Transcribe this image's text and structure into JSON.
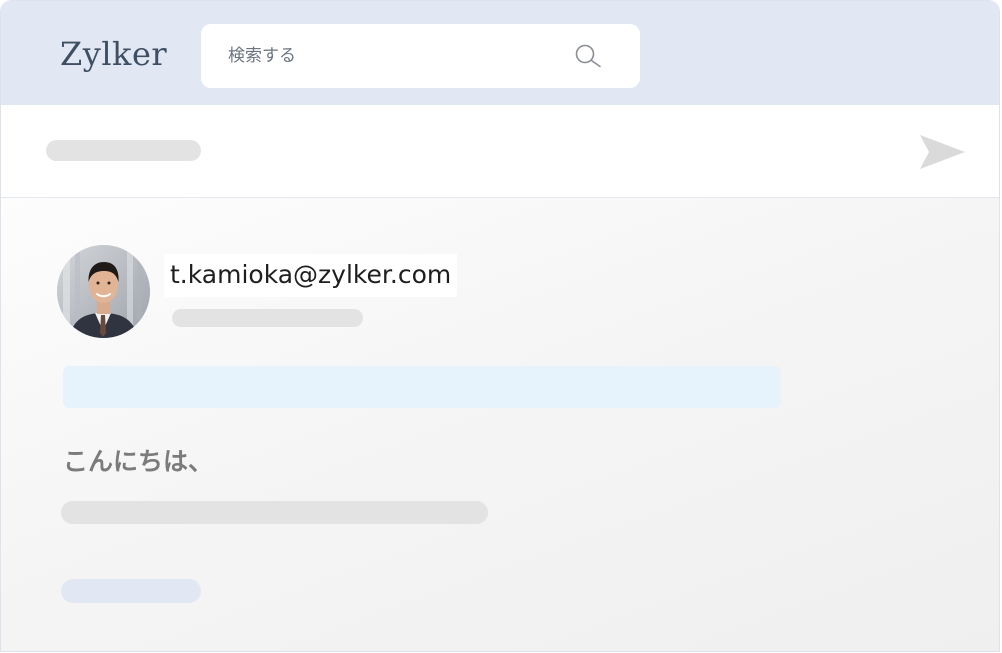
{
  "header": {
    "brand": "Zylker",
    "search": {
      "placeholder": "検索する",
      "value": ""
    }
  },
  "compose": {
    "send_icon": "send-icon"
  },
  "message": {
    "sender_email": "t.kamioka@zylker.com",
    "avatar": "avatar",
    "greeting": "こんにちは、"
  },
  "colors": {
    "header_bg": "#e1e8f3",
    "brand_text": "#3f4f63",
    "placeholder_gray": "#e3e3e3",
    "highlight_blue": "#e7f3fc",
    "link_bar_blue": "#e1e8f3",
    "send_icon": "#dadada"
  }
}
